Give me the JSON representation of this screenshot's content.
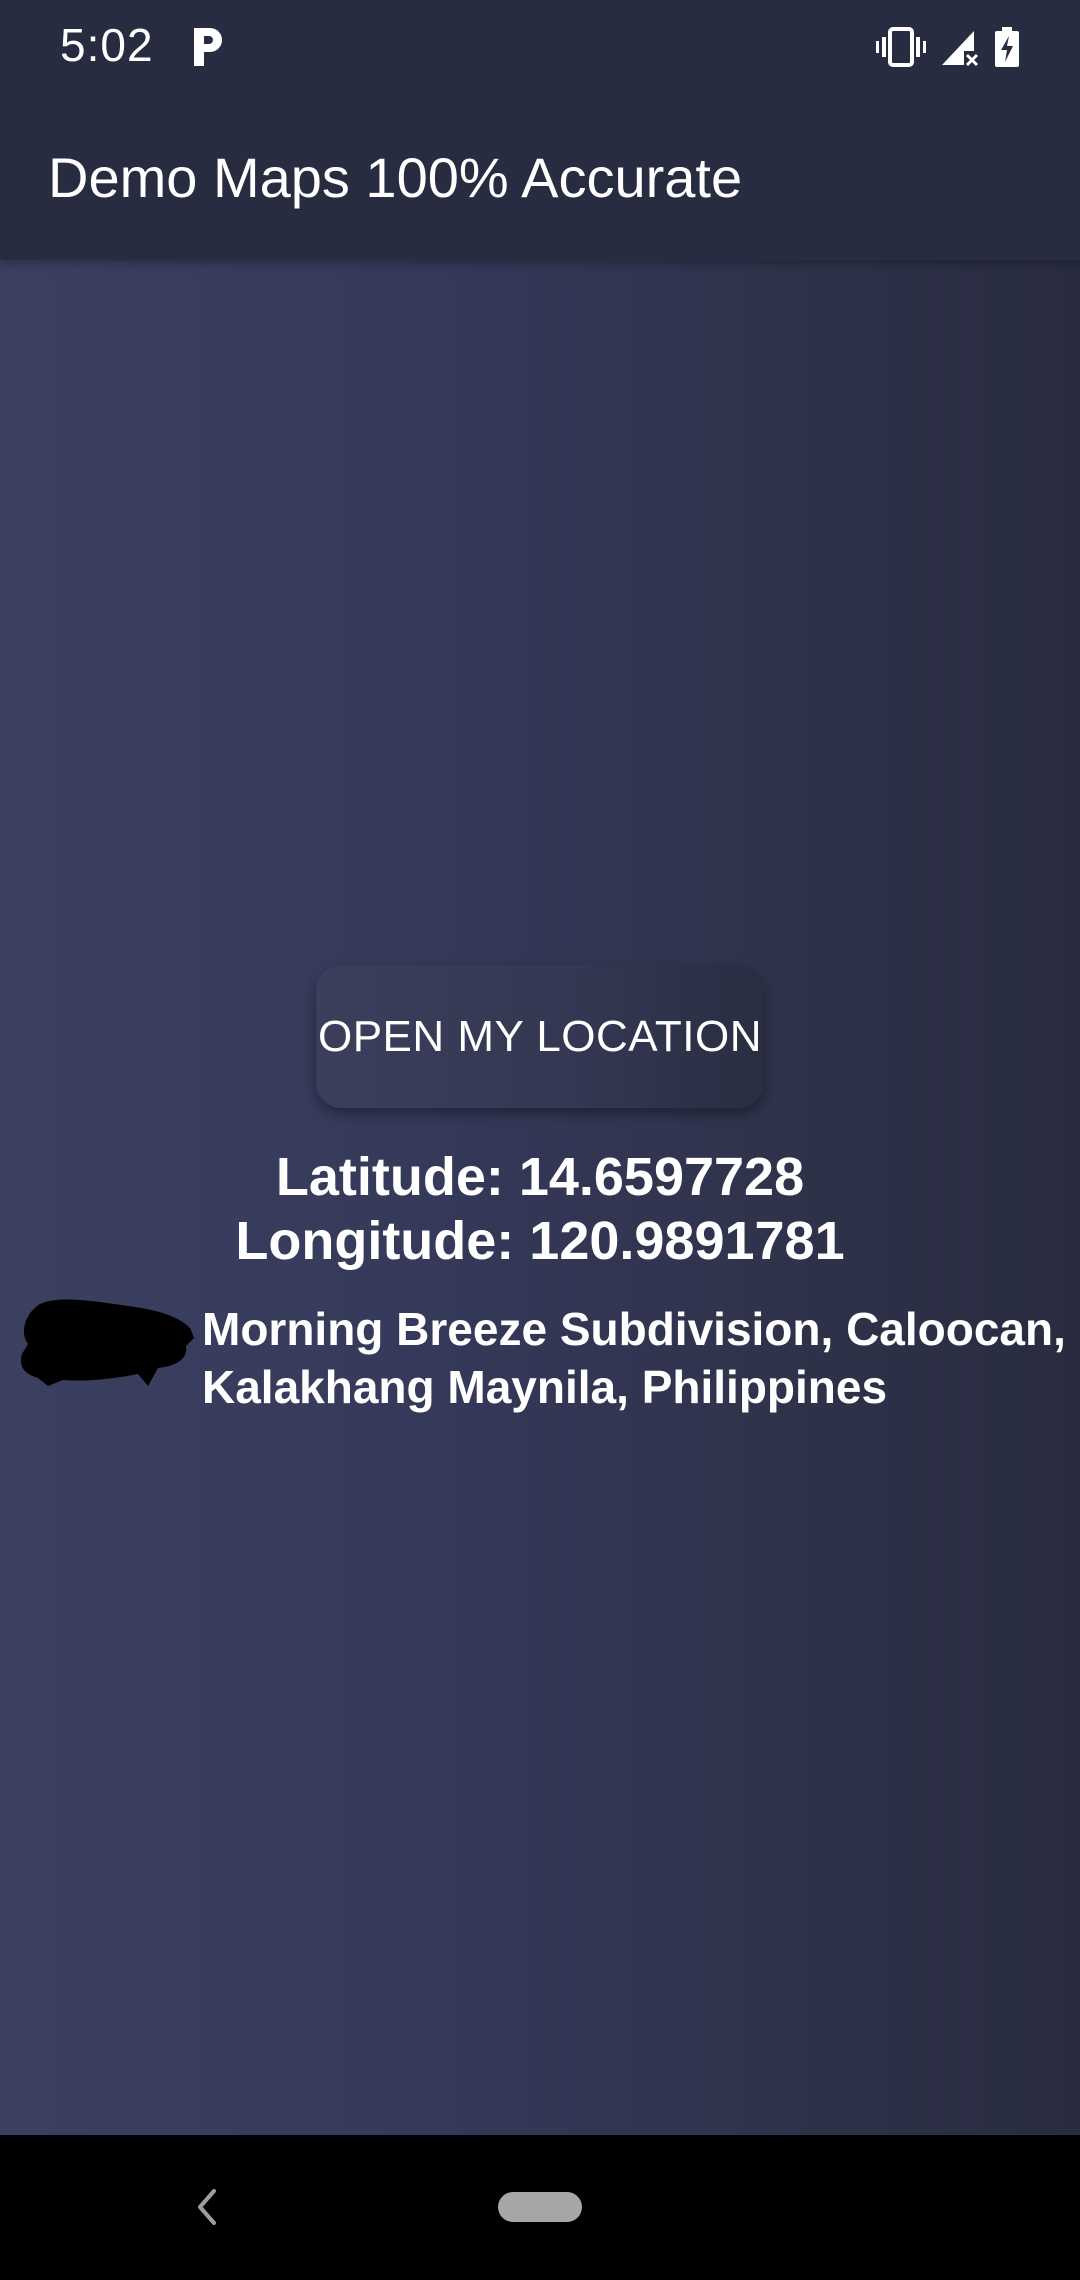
{
  "status_bar": {
    "time": "5:02",
    "notification_icon": "p-icon",
    "icons": [
      "vibrate-icon",
      "signal-icon",
      "battery-charging-icon"
    ]
  },
  "app_bar": {
    "title": "Demo Maps 100% Accurate"
  },
  "main": {
    "button_label": "OPEN MY LOCATION",
    "latitude_text": "Latitude: 14.6597728",
    "longitude_text": "Longitude: 120.9891781",
    "address_line1": "Morning Breeze Subdivision, Caloocan,",
    "address_line2": "Kalakhang Maynila, Philippines"
  },
  "nav_bar": {
    "icons": [
      "back-icon",
      "home-pill"
    ]
  },
  "colors": {
    "app_bar_bg": "#282c40",
    "content_gradient_start": "#3c4060",
    "content_gradient_end": "#292c40",
    "nav_bar_bg": "#000000"
  }
}
